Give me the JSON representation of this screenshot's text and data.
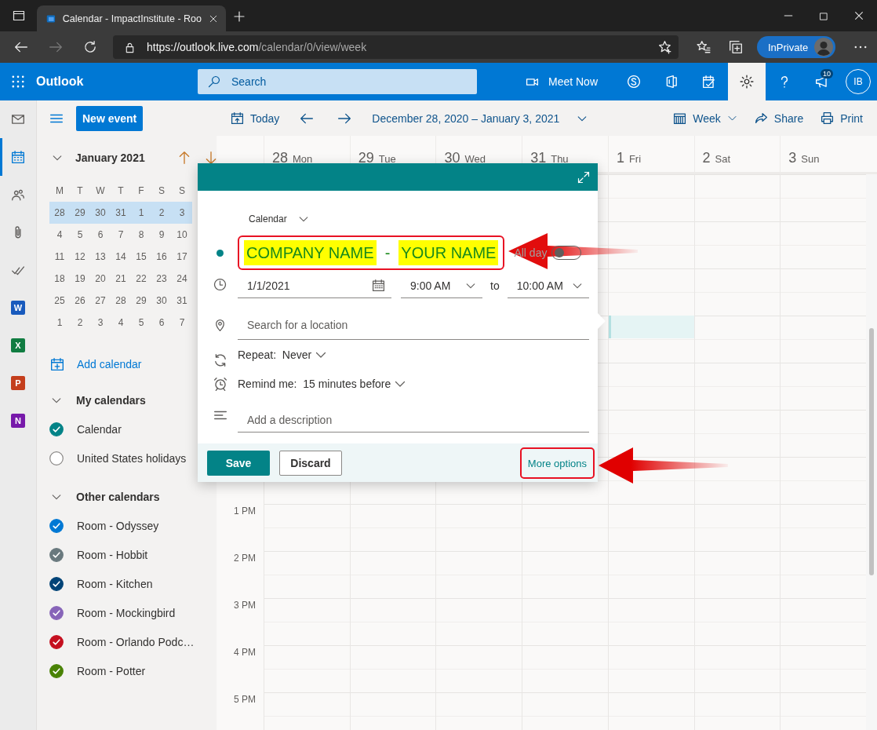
{
  "browser": {
    "tab_title": "Calendar - ImpactInstitute - Roo",
    "url": {
      "host": "https://outlook.live.com",
      "path": "/calendar/0/view/week"
    },
    "profile": "InPrivate"
  },
  "app_bar": {
    "brand": "Outlook",
    "search": {
      "placeholder": "Search"
    },
    "meet_now": "Meet Now",
    "actions": [
      {
        "kind": "skype",
        "selected": false
      },
      {
        "kind": "office",
        "selected": false
      },
      {
        "kind": "todo",
        "selected": false
      },
      {
        "kind": "settings",
        "selected": true
      },
      {
        "kind": "help",
        "selected": false
      },
      {
        "kind": "feedback",
        "selected": false,
        "badge": "10"
      }
    ],
    "avatar": "IB"
  },
  "rail": [
    {
      "kind": "mail",
      "selected": false
    },
    {
      "kind": "calendar",
      "selected": true
    },
    {
      "kind": "people",
      "selected": false
    },
    {
      "kind": "files",
      "selected": false
    },
    {
      "kind": "todo",
      "selected": false
    },
    {
      "kind": "app",
      "letter": "W",
      "color": "#185abd",
      "selected": false
    },
    {
      "kind": "app",
      "letter": "X",
      "color": "#107c41",
      "selected": false
    },
    {
      "kind": "app",
      "letter": "P",
      "color": "#c43e1c",
      "selected": false
    },
    {
      "kind": "app",
      "letter": "N",
      "color": "#7719aa",
      "selected": false
    }
  ],
  "sidebar": {
    "new_event": "New event",
    "mini_calendar": {
      "month": "January 2021",
      "weekdays": [
        "M",
        "T",
        "W",
        "T",
        "F",
        "S",
        "S"
      ],
      "weeks": [
        {
          "selected": true,
          "days": [
            "28",
            "29",
            "30",
            "31",
            "1",
            "2",
            "3"
          ]
        },
        {
          "selected": false,
          "days": [
            "4",
            "5",
            "6",
            "7",
            "8",
            "9",
            "10"
          ]
        },
        {
          "selected": false,
          "days": [
            "11",
            "12",
            "13",
            "14",
            "15",
            "16",
            "17"
          ]
        },
        {
          "selected": false,
          "days": [
            "18",
            "19",
            "20",
            "21",
            "22",
            "23",
            "24"
          ]
        },
        {
          "selected": false,
          "days": [
            "25",
            "26",
            "27",
            "28",
            "29",
            "30",
            "31"
          ]
        },
        {
          "selected": false,
          "days": [
            "1",
            "2",
            "3",
            "4",
            "5",
            "6",
            "7"
          ]
        }
      ]
    },
    "add_calendar": "Add calendar",
    "groups": [
      {
        "title": "My calendars",
        "expanded": true,
        "items": [
          {
            "name": "Calendar",
            "checked": true,
            "color": "#038387"
          },
          {
            "name": "United States holidays",
            "checked": false
          }
        ]
      },
      {
        "title": "Other calendars",
        "expanded": true,
        "items": [
          {
            "name": "Room - Odyssey",
            "checked": true,
            "color": "#0078d4"
          },
          {
            "name": "Room - Hobbit",
            "checked": true,
            "color": "#69797e"
          },
          {
            "name": "Room - Kitchen",
            "checked": true,
            "color": "#004377"
          },
          {
            "name": "Room - Mockingbird",
            "checked": true,
            "color": "#8764b8"
          },
          {
            "name": "Room - Orlando Podc…",
            "checked": true,
            "color": "#c50f1f"
          },
          {
            "name": "Room - Potter",
            "checked": true,
            "color": "#498205"
          }
        ]
      }
    ]
  },
  "toolbar": {
    "today": "Today",
    "range": "December 28, 2020 – January 3, 2021",
    "view": "Week",
    "share": "Share",
    "print": "Print"
  },
  "days": [
    {
      "number": "28",
      "name": "Mon"
    },
    {
      "number": "29",
      "name": "Tue"
    },
    {
      "number": "30",
      "name": "Wed"
    },
    {
      "number": "31",
      "name": "Thu"
    },
    {
      "number": "1",
      "name": "Fri",
      "draft": true
    },
    {
      "number": "2",
      "name": "Sat"
    },
    {
      "number": "3",
      "name": "Sun"
    }
  ],
  "hours": [
    "1 PM",
    "2 PM",
    "3 PM",
    "4 PM",
    "5 PM"
  ],
  "event_popup": {
    "calendar": "Calendar",
    "title_segments": [
      {
        "text": "COMPANY NAME",
        "highlighted": true
      },
      {
        "text": "-",
        "highlighted": false
      },
      {
        "text": "YOUR NAME",
        "highlighted": true
      }
    ],
    "all_day": {
      "label": "All day",
      "on": false
    },
    "date": "1/1/2021",
    "start": "9:00 AM",
    "to": "to",
    "end": "10:00 AM",
    "location": {
      "placeholder": "Search for a location"
    },
    "repeat": {
      "label": "Repeat:",
      "value": "Never"
    },
    "remind": {
      "label": "Remind me:",
      "value": "15 minutes before"
    },
    "description": {
      "placeholder": "Add a description"
    },
    "save": "Save",
    "discard": "Discard",
    "more_options": "More options"
  },
  "annotations": {
    "title_marked": true,
    "more_options_marked": true
  }
}
